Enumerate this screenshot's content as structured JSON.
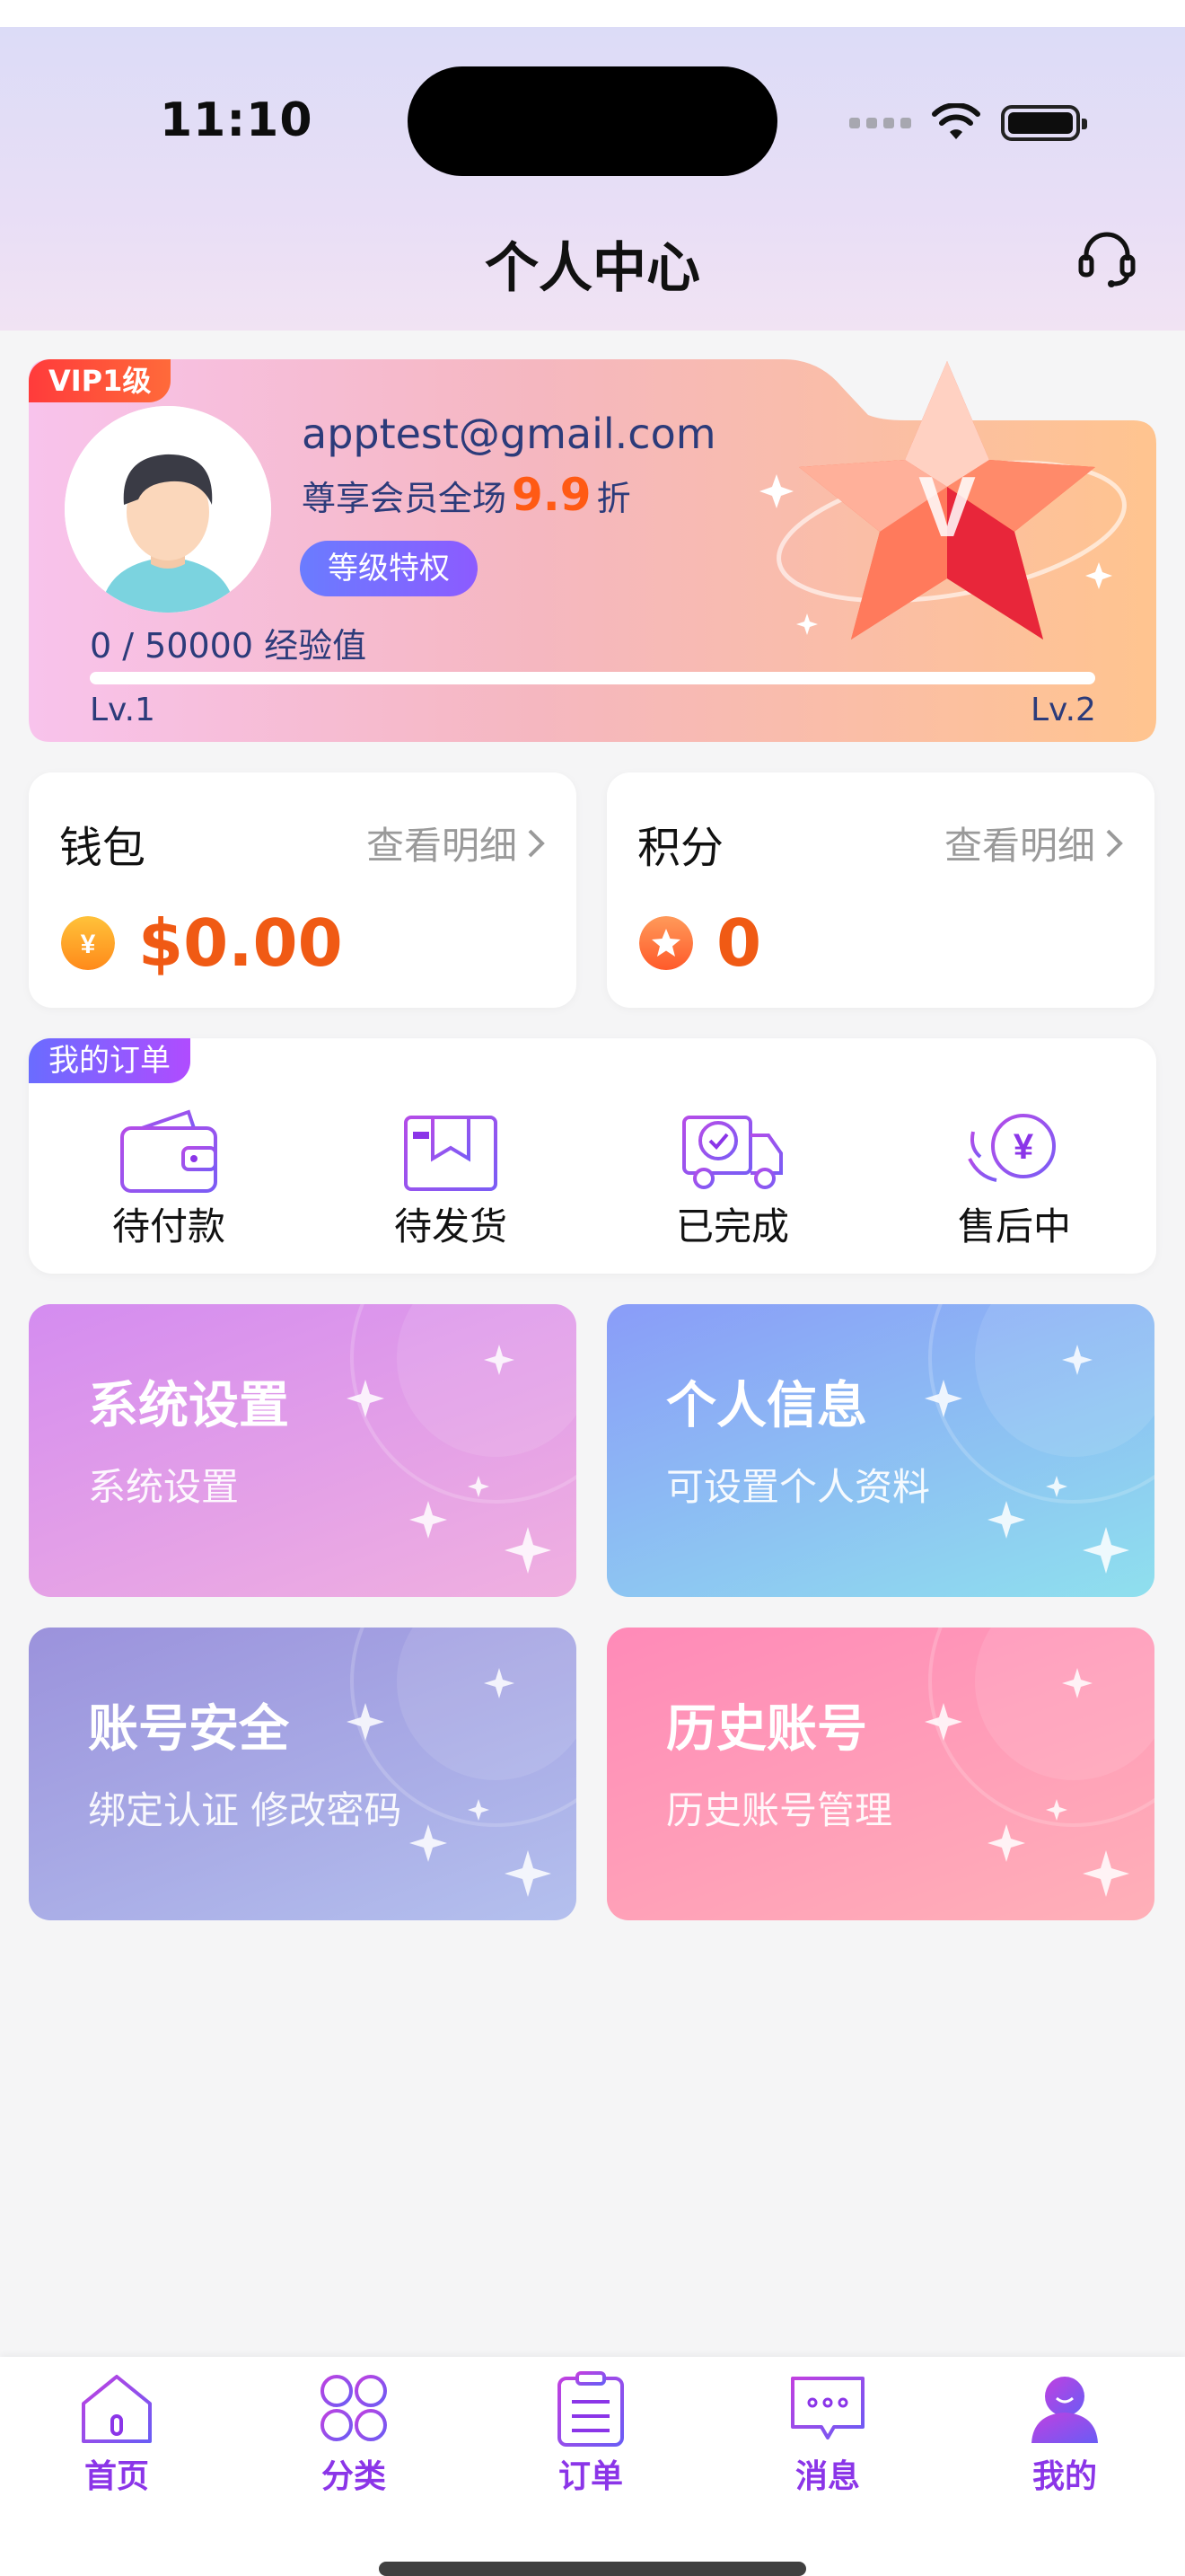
{
  "status": {
    "time": "11:10"
  },
  "header": {
    "title": "个人中心"
  },
  "vip": {
    "badge": "VIP1级",
    "email": "apptest@gmail.com",
    "discount_prefix": "尊享会员全场",
    "discount_value": "9.9",
    "discount_suffix": "折",
    "privilege_button": "等级特权",
    "exp_text": "0 / 50000  经验值",
    "exp_progress": 0.0,
    "level_current": "Lv.1",
    "level_next": "Lv.2"
  },
  "wallet": {
    "label": "钱包",
    "detail": "查看明细",
    "value": "$0.00",
    "coin_symbol": "¥"
  },
  "points": {
    "label": "积分",
    "detail": "查看明细",
    "value": "0"
  },
  "orders": {
    "tag": "我的订单",
    "items": [
      {
        "label": "待付款",
        "icon": "wallet-icon"
      },
      {
        "label": "待发货",
        "icon": "box-icon"
      },
      {
        "label": "已完成",
        "icon": "truck-icon"
      },
      {
        "label": "售后中",
        "icon": "refund-icon"
      }
    ]
  },
  "tiles": [
    {
      "title": "系统设置",
      "subtitle": "系统设置"
    },
    {
      "title": "个人信息",
      "subtitle": "可设置个人资料"
    },
    {
      "title": "账号安全",
      "subtitle": "绑定认证 修改密码"
    },
    {
      "title": "历史账号",
      "subtitle": "历史账号管理"
    }
  ],
  "tabbar": {
    "active": "我的",
    "items": [
      {
        "label": "首页",
        "icon": "home-icon"
      },
      {
        "label": "分类",
        "icon": "grid-icon"
      },
      {
        "label": "订单",
        "icon": "clipboard-icon"
      },
      {
        "label": "消息",
        "icon": "message-icon"
      },
      {
        "label": "我的",
        "icon": "profile-icon"
      }
    ]
  },
  "colors": {
    "accent_purple": "#8b35e8",
    "price_orange": "#f05a14",
    "vip_text": "#2c3b7a"
  }
}
